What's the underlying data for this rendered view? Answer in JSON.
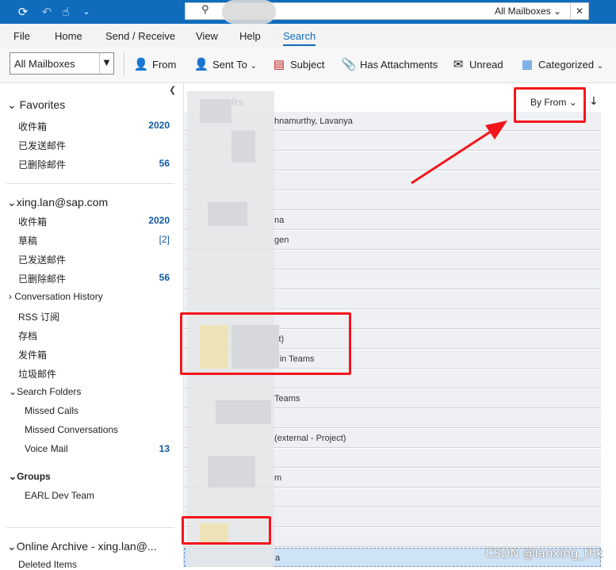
{
  "titlebar": {
    "search_scope": "All Mailboxes",
    "icons": [
      "sync-icon",
      "undo-icon",
      "touch-mode-icon",
      "customize-icon",
      "search-icon",
      "close-icon"
    ]
  },
  "menu": {
    "tabs": [
      "File",
      "Home",
      "Send / Receive",
      "View",
      "Help",
      "Search"
    ],
    "active": "Search"
  },
  "ribbon": {
    "scope_select": "All Mailboxes",
    "from": "From",
    "sent_to": "Sent To",
    "subject": "Subject",
    "has_attachments": "Has Attachments",
    "unread": "Unread",
    "categorized": "Categorized"
  },
  "folders": {
    "favorites": {
      "header": "Favorites",
      "items": [
        {
          "label": "收件箱",
          "count": "2020"
        },
        {
          "label": "已发送邮件",
          "count": ""
        },
        {
          "label": "已删除邮件",
          "count": "56"
        }
      ]
    },
    "account": {
      "header": "xing.lan@sap.com",
      "items": [
        {
          "label": "收件箱",
          "count": "2020"
        },
        {
          "label": "草稿",
          "count": "[2]"
        },
        {
          "label": "已发送邮件",
          "count": ""
        },
        {
          "label": "已删除邮件",
          "count": "56"
        },
        {
          "label": "Conversation History",
          "count": ""
        },
        {
          "label": "RSS 订阅",
          "count": ""
        },
        {
          "label": "存档",
          "count": ""
        },
        {
          "label": "发件箱",
          "count": ""
        },
        {
          "label": "垃圾邮件",
          "count": ""
        }
      ]
    },
    "search_folders": {
      "header": "Search Folders",
      "items": [
        {
          "label": "Missed Calls",
          "count": ""
        },
        {
          "label": "Missed Conversations",
          "count": ""
        },
        {
          "label": "Voice Mail",
          "count": "13"
        }
      ]
    },
    "groups": {
      "header": "Groups",
      "items": [
        {
          "label": "EARL Dev Team"
        }
      ]
    },
    "archive": {
      "header": "Online Archive - xing.lan@...",
      "items": [
        {
          "label": "Deleted Items"
        }
      ]
    }
  },
  "list": {
    "results_label": "sults",
    "sort_by": "By From",
    "rows": [
      "hnamurthy, Lavanya",
      "",
      "",
      "",
      "",
      "na",
      "gen",
      "",
      "",
      "",
      "",
      "ct)",
      ") in Teams",
      "",
      "Teams",
      "",
      "(external - Project)",
      "",
      "m",
      "",
      "",
      "",
      "a"
    ]
  },
  "watermark": "CSDN @lanxing_thk"
}
